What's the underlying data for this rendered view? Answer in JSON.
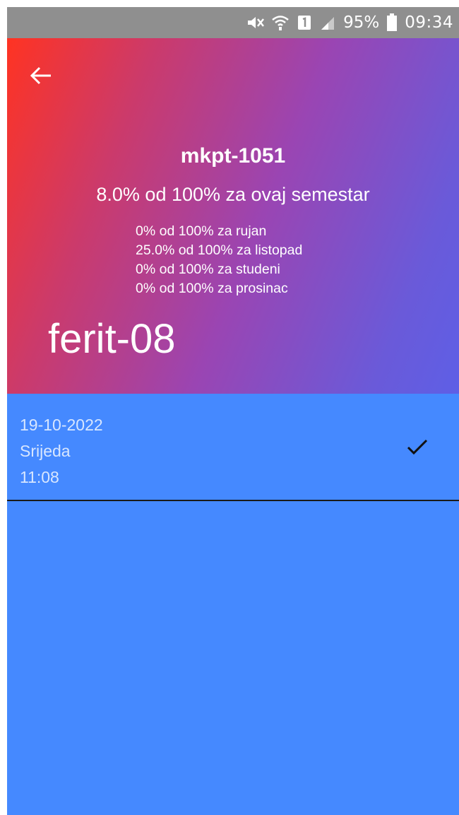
{
  "status_bar": {
    "battery_percent": "95%",
    "time": "09:34",
    "icons": [
      "silent-mode-icon",
      "wifi-icon",
      "sim-1-icon",
      "signal-icon",
      "battery-icon"
    ]
  },
  "header": {
    "back_icon": "arrow-left-icon",
    "course_code": "mkpt-1051",
    "semester_summary": "8.0% od 100% za ovaj semestar",
    "months": [
      "0% od 100% za rujan",
      "25.0% od 100% za listopad",
      "0% od 100% za studeni",
      "0% od 100% za prosinac"
    ],
    "room": "ferit-08",
    "gradient_colors": [
      "#ff3322",
      "#cc3a6a",
      "#9a45b3",
      "#6a5ad9",
      "#5e5fe6"
    ]
  },
  "attendance": [
    {
      "date": "19-10-2022",
      "day": "Srijeda",
      "time": "11:08",
      "status_icon": "checkmark-icon"
    }
  ],
  "colors": {
    "list_background": "#4589ff",
    "status_bar": "#8f8f8f",
    "row_text": "#d7e6ff"
  }
}
